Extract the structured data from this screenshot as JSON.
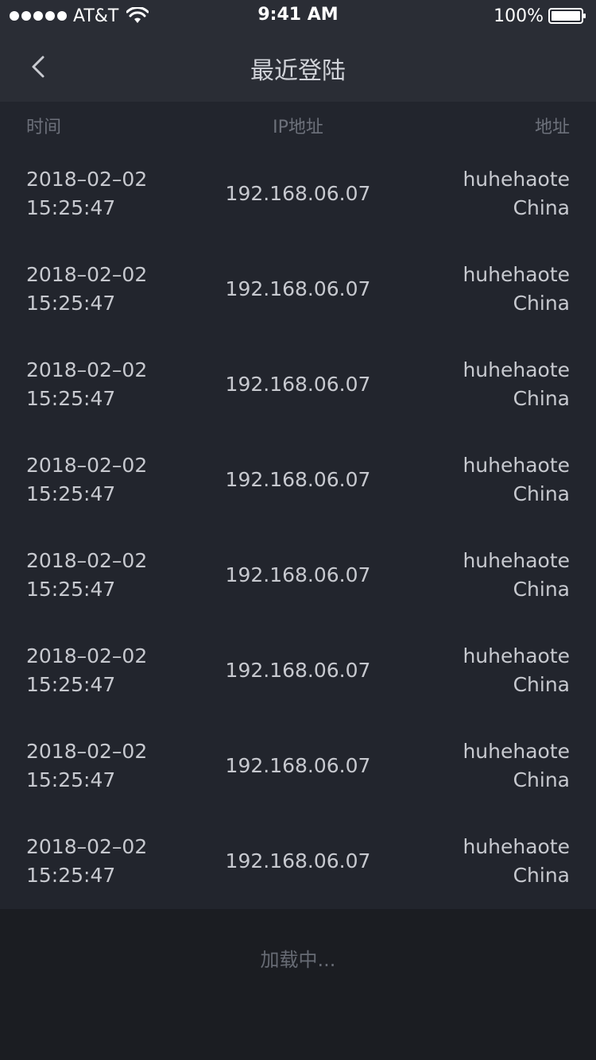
{
  "status_bar": {
    "carrier": "AT&T",
    "time": "9:41 AM",
    "battery": "100%"
  },
  "nav": {
    "title": "最近登陆"
  },
  "table": {
    "headers": {
      "time": "时间",
      "ip": "IP地址",
      "address": "地址"
    },
    "rows": [
      {
        "date": "2018–02–02",
        "time": "15:25:47",
        "ip": "192.168.06.07",
        "city": "huhehaote",
        "country": "China"
      },
      {
        "date": "2018–02–02",
        "time": "15:25:47",
        "ip": "192.168.06.07",
        "city": "huhehaote",
        "country": "China"
      },
      {
        "date": "2018–02–02",
        "time": "15:25:47",
        "ip": "192.168.06.07",
        "city": "huhehaote",
        "country": "China"
      },
      {
        "date": "2018–02–02",
        "time": "15:25:47",
        "ip": "192.168.06.07",
        "city": "huhehaote",
        "country": "China"
      },
      {
        "date": "2018–02–02",
        "time": "15:25:47",
        "ip": "192.168.06.07",
        "city": "huhehaote",
        "country": "China"
      },
      {
        "date": "2018–02–02",
        "time": "15:25:47",
        "ip": "192.168.06.07",
        "city": "huhehaote",
        "country": "China"
      },
      {
        "date": "2018–02–02",
        "time": "15:25:47",
        "ip": "192.168.06.07",
        "city": "huhehaote",
        "country": "China"
      },
      {
        "date": "2018–02–02",
        "time": "15:25:47",
        "ip": "192.168.06.07",
        "city": "huhehaote",
        "country": "China"
      }
    ]
  },
  "footer": {
    "loading": "加载中..."
  },
  "colors": {
    "nav_bg": "#2a2d35",
    "content_bg": "#22252d",
    "footer_bg": "#1b1d22",
    "text": "#c7c9cf",
    "muted": "#6d717b"
  },
  "icons": {
    "back": "chevron-left-icon",
    "wifi": "wifi-icon",
    "battery": "battery-icon",
    "signal": "signal-dots-icon"
  }
}
